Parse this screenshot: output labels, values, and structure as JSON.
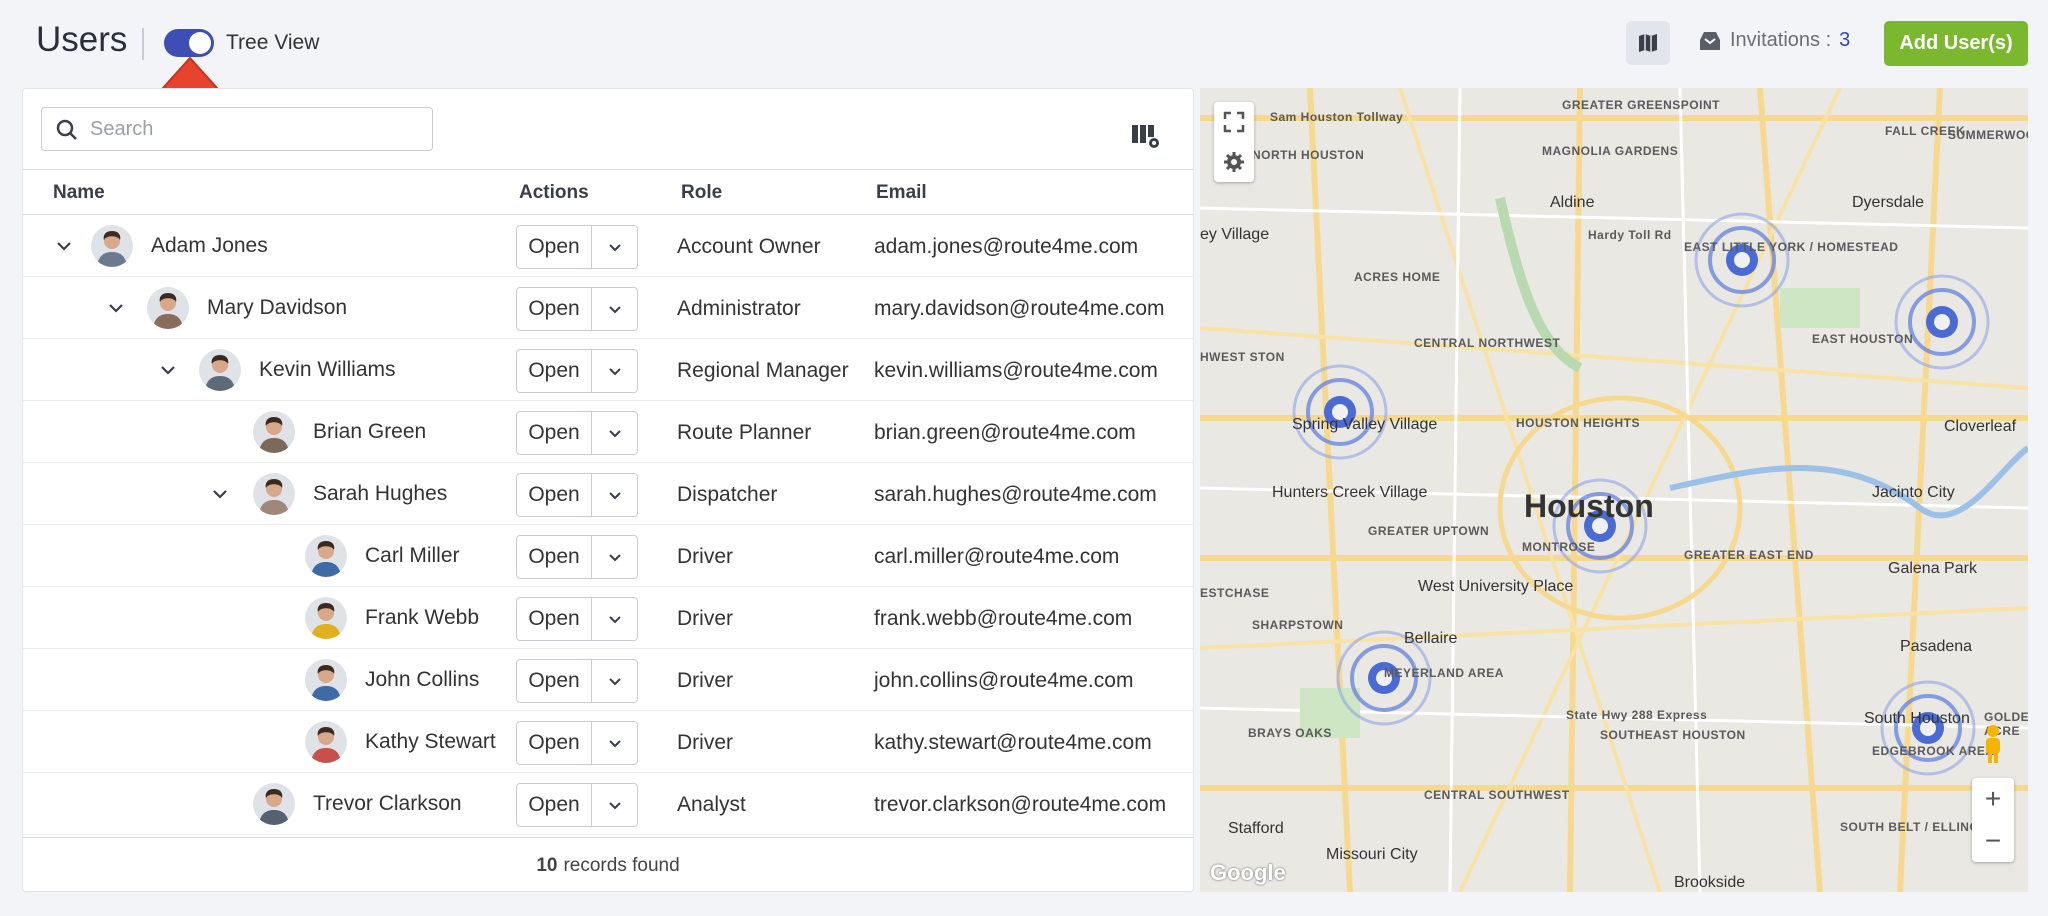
{
  "header": {
    "title": "Users",
    "tree_view_label": "Tree View",
    "tree_view_on": true,
    "invitations_label": "Invitations :",
    "invitations_count": "3",
    "add_button": "Add User(s)"
  },
  "search": {
    "placeholder": "Search"
  },
  "table": {
    "columns": [
      "Name",
      "Actions",
      "Role",
      "Email"
    ],
    "open_label": "Open",
    "rows": [
      {
        "name": "Adam Jones",
        "role": "Account Owner",
        "email": "adam.jones@route4me.com"
      },
      {
        "name": "Mary Davidson",
        "role": "Administrator",
        "email": "mary.davidson@route4me.com"
      },
      {
        "name": "Kevin Williams",
        "role": "Regional Manager",
        "email": "kevin.williams@route4me.com"
      },
      {
        "name": "Brian Green",
        "role": "Route Planner",
        "email": "brian.green@route4me.com"
      },
      {
        "name": "Sarah Hughes",
        "role": "Dispatcher",
        "email": "sarah.hughes@route4me.com"
      },
      {
        "name": "Carl Miller",
        "role": "Driver",
        "email": "carl.miller@route4me.com"
      },
      {
        "name": "Frank Webb",
        "role": "Driver",
        "email": "frank.webb@route4me.com"
      },
      {
        "name": "John Collins",
        "role": "Driver",
        "email": "john.collins@route4me.com"
      },
      {
        "name": "Kathy Stewart",
        "role": "Driver",
        "email": "kathy.stewart@route4me.com"
      },
      {
        "name": "Trevor Clarkson",
        "role": "Analyst",
        "email": "trevor.clarkson@route4me.com"
      }
    ],
    "footer_count": "10",
    "footer_text": "records found"
  },
  "map": {
    "big_label": "Houston",
    "labels": [
      "GREATER GREENSPOINT",
      "FALL CREEK",
      "SUMMERWOOD",
      "NORTH HOUSTON",
      "MAGNOLIA GARDENS",
      "Aldine",
      "Dyersdale",
      "ACRES HOME",
      "EAST LITTLE YORK / HOMESTEAD",
      "EAST HOUSTON",
      "CENTRAL NORTHWEST",
      "Spring Valley Village",
      "HOUSTON HEIGHTS",
      "Cloverleaf",
      "Hunters Creek Village",
      "GREATER UPTOWN",
      "MONTROSE",
      "Jacinto City",
      "GREATER EAST END",
      "Galena Park",
      "West University Place",
      "SHARPSTOWN",
      "Bellaire",
      "Pasadena",
      "MEYERLAND AREA",
      "SOUTHEAST HOUSTON",
      "South Houston",
      "EDGEBROOK AREA",
      "BRAYS OAKS",
      "CENTRAL SOUTHWEST",
      "SOUTH BELT / ELLINGTON",
      "Stafford",
      "Missouri City",
      "Brookside",
      "Sam Houston Tollway",
      "Hardy Toll Rd",
      "State Hwy 288 Express",
      "ey Village",
      "HWEST STON",
      "ESTCHASE",
      "GOLDEN ACRE"
    ],
    "attribution": "Google"
  },
  "colors": {
    "accent": "#3d4fb5",
    "add_button": "#7cb82f",
    "annotation_arrow": "#e8432f",
    "marker": "#4a6ad6"
  },
  "icons": [
    "map-icon",
    "inbox-icon",
    "search-icon",
    "columns-settings-icon",
    "chevron-down-icon",
    "fullscreen-icon",
    "gear-icon",
    "pegman-icon",
    "arrow-up-icon"
  ]
}
